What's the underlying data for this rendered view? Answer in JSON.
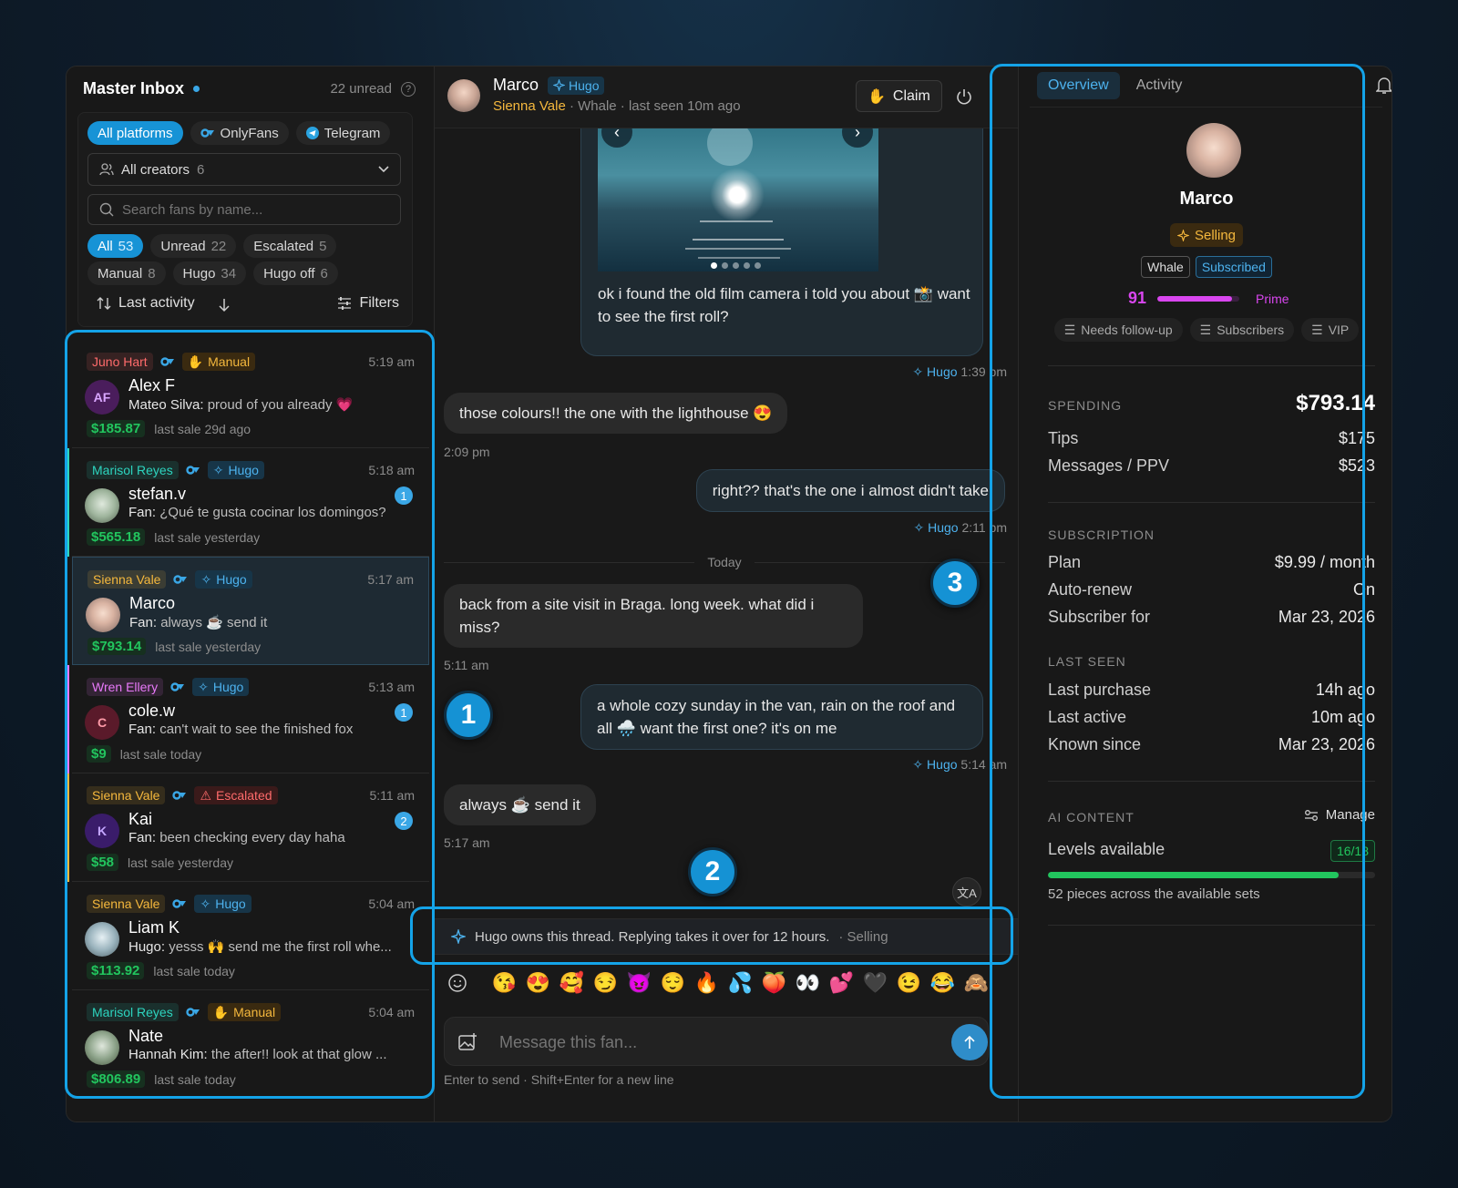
{
  "inbox": {
    "title": "Master Inbox",
    "unread": "22 unread",
    "platforms": [
      {
        "label": "All platforms",
        "active": true
      },
      {
        "label": "OnlyFans",
        "active": false
      },
      {
        "label": "Telegram",
        "active": false
      }
    ],
    "creator_select": {
      "label": "All creators",
      "count": "6"
    },
    "search_placeholder": "Search fans by name...",
    "filters": [
      {
        "label": "All",
        "count": "53",
        "active": true
      },
      {
        "label": "Unread",
        "count": "22",
        "active": false
      },
      {
        "label": "Escalated",
        "count": "5",
        "active": false
      },
      {
        "label": "Manual",
        "count": "8",
        "active": false
      },
      {
        "label": "Hugo",
        "count": "34",
        "active": false
      },
      {
        "label": "Hugo off",
        "count": "6",
        "active": false
      }
    ],
    "sort_label": "Last activity",
    "filters_label": "Filters",
    "conversations": [
      {
        "creator": "Juno Hart",
        "creator_color": "#ff6b6b",
        "mode": "Manual",
        "time": "5:19 am",
        "avatar": "AF",
        "name": "Alex F",
        "sender": "Mateo Silva:",
        "preview": "proud of you already 💗",
        "amount": "$185.87",
        "last_sale": "last sale 29d ago",
        "unread": ""
      },
      {
        "creator": "Marisol Reyes",
        "creator_color": "#2dd4bf",
        "mode": "Hugo",
        "time": "5:18 am",
        "avatar": "",
        "name": "stefan.v",
        "sender": "Fan:",
        "preview": "¿Qué te gusta cocinar los domingos?",
        "amount": "$565.18",
        "last_sale": "last sale yesterday",
        "unread": "1"
      },
      {
        "creator": "Sienna Vale",
        "creator_color": "#f5b83d",
        "mode": "Hugo",
        "time": "5:17 am",
        "avatar": "",
        "name": "Marco",
        "sender": "Fan:",
        "preview": "always ☕ send it",
        "amount": "$793.14",
        "last_sale": "last sale yesterday",
        "unread": ""
      },
      {
        "creator": "Wren Ellery",
        "creator_color": "#e879f9",
        "mode": "Hugo",
        "time": "5:13 am",
        "avatar": "C",
        "name": "cole.w",
        "sender": "Fan:",
        "preview": "can't wait to see the finished fox",
        "amount": "$9",
        "last_sale": "last sale today",
        "unread": "1"
      },
      {
        "creator": "Sienna Vale",
        "creator_color": "#f5b83d",
        "mode": "Escalated",
        "time": "5:11 am",
        "avatar": "K",
        "name": "Kai",
        "sender": "Fan:",
        "preview": "been checking every day haha",
        "amount": "$58",
        "last_sale": "last sale yesterday",
        "unread": "2"
      },
      {
        "creator": "Sienna Vale",
        "creator_color": "#f5b83d",
        "mode": "Hugo",
        "time": "5:04 am",
        "avatar": "",
        "name": "Liam K",
        "sender": "Hugo:",
        "preview": "yesss 🙌 send me the first roll whe...",
        "amount": "$113.92",
        "last_sale": "last sale today",
        "unread": ""
      },
      {
        "creator": "Marisol Reyes",
        "creator_color": "#2dd4bf",
        "mode": "Manual",
        "time": "5:04 am",
        "avatar": "",
        "name": "Nate",
        "sender": "Hannah Kim:",
        "preview": "the after!! look at that glow ...",
        "amount": "$806.89",
        "last_sale": "last sale today",
        "unread": ""
      }
    ]
  },
  "chat": {
    "fan_name": "Marco",
    "mode": "Hugo",
    "creator": "Sienna Vale",
    "subtitle": " · Whale · last seen 10m ago",
    "claim_label": "Claim",
    "messages": [
      {
        "dir": "out",
        "text": "ok i found the old film camera i told you about 📸 want to see the first roll?",
        "author": "Hugo",
        "time": "1:39 pm",
        "has_image": true
      },
      {
        "dir": "in",
        "text": "those colours!! the one with the lighthouse 😍",
        "time": "2:09 pm"
      },
      {
        "dir": "out",
        "text": "right?? that's the one i almost didn't take",
        "author": "Hugo",
        "time": "2:11 pm"
      },
      {
        "dir": "in",
        "text": "back from a site visit in Braga. long week. what did i miss?",
        "time": "5:11 am"
      },
      {
        "dir": "out",
        "text": "a whole cozy sunday in the van, rain on the roof and all 🌧️ want the first one? it's on me",
        "author": "Hugo",
        "time": "5:14 am"
      },
      {
        "dir": "in",
        "text": "always ☕ send it",
        "time": "5:17 am"
      }
    ],
    "day_divider": "Today",
    "notice": "Hugo owns this thread. Replying takes it over for 12 hours.",
    "notice_state": "· Selling",
    "emojis": [
      "😘",
      "😍",
      "🥰",
      "😏",
      "😈",
      "😌",
      "🔥",
      "💦",
      "🍑",
      "👀",
      "💕",
      "🖤",
      "😉",
      "😂",
      "🙈"
    ],
    "input_placeholder": "Message this fan...",
    "hint": "Enter to send · Shift+Enter for a new line"
  },
  "profile": {
    "tabs": [
      {
        "label": "Overview",
        "active": true
      },
      {
        "label": "Activity",
        "active": false
      }
    ],
    "name": "Marco",
    "status": "Selling",
    "badges": [
      "Whale",
      "Subscribed"
    ],
    "score": "91",
    "score_fraction": 0.91,
    "tier": "Prime",
    "lists": [
      "Needs follow-up",
      "Subscribers",
      "VIP"
    ],
    "spending": {
      "label": "SPENDING",
      "total": "$793.14",
      "rows": [
        {
          "k": "Tips",
          "v": "$175"
        },
        {
          "k": "Messages / PPV",
          "v": "$523"
        }
      ]
    },
    "subscription": {
      "label": "SUBSCRIPTION",
      "rows": [
        {
          "k": "Plan",
          "v": "$9.99 / month"
        },
        {
          "k": "Auto-renew",
          "v": "On"
        },
        {
          "k": "Subscriber for",
          "v": "Mar 23, 2026"
        }
      ]
    },
    "last_seen": {
      "label": "LAST SEEN",
      "rows": [
        {
          "k": "Last purchase",
          "v": "14h ago"
        },
        {
          "k": "Last active",
          "v": "10m ago"
        },
        {
          "k": "Known since",
          "v": "Mar 23, 2026"
        }
      ]
    },
    "ai_content": {
      "label": "AI CONTENT",
      "manage": "Manage",
      "levels_label": "Levels available",
      "levels": "16/18",
      "levels_fraction": 0.889,
      "footer": "52 pieces across the available sets"
    }
  },
  "callouts": [
    "1",
    "2",
    "3"
  ],
  "colors": {
    "accent": "#1793d6",
    "highlight": "#14a3e8",
    "money": "#22c55e",
    "creator_gold": "#f5b83d",
    "score": "#d946ef"
  }
}
